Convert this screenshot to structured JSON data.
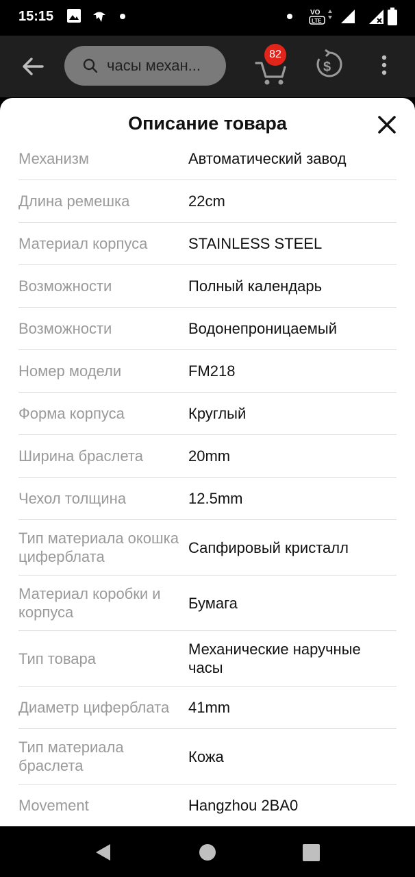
{
  "status_bar": {
    "time": "15:15",
    "icons": [
      "gallery-icon",
      "app-notification-icon",
      "dot-icon",
      "dot-icon",
      "volte-icon",
      "signal-icon",
      "signal-no-data-icon",
      "battery-icon"
    ]
  },
  "app_bar": {
    "search_text": "часы механ...",
    "cart_count": "82"
  },
  "sheet": {
    "title": "Описание товара",
    "rows": [
      {
        "label": "Механизм",
        "value": "Автоматический завод"
      },
      {
        "label": "Длина ремешка",
        "value": "22cm"
      },
      {
        "label": "Материал корпуса",
        "value": "STAINLESS STEEL"
      },
      {
        "label": "Возможности",
        "value": "Полный календарь"
      },
      {
        "label": "Возможности",
        "value": "Водонепроницаемый"
      },
      {
        "label": "Номер модели",
        "value": "FM218"
      },
      {
        "label": "Форма корпуса",
        "value": "Круглый"
      },
      {
        "label": "Ширина браслета",
        "value": "20mm"
      },
      {
        "label": "Чехол толщина",
        "value": "12.5mm"
      },
      {
        "label": "Тип материала окошка циферблата",
        "value": "Сапфировый кристалл"
      },
      {
        "label": "Материал коробки и корпуса",
        "value": "Бумага"
      },
      {
        "label": "Тип товара",
        "value": "Механические наручные часы"
      },
      {
        "label": "Диаметр циферблата",
        "value": "41mm"
      },
      {
        "label": "Тип материала браслета",
        "value": "Кожа"
      },
      {
        "label": "Movement",
        "value": "Hangzhou 2BA0"
      }
    ]
  },
  "colors": {
    "badge": "#e1251b",
    "label": "#9a9a9a",
    "divider": "#dcdcdc"
  }
}
